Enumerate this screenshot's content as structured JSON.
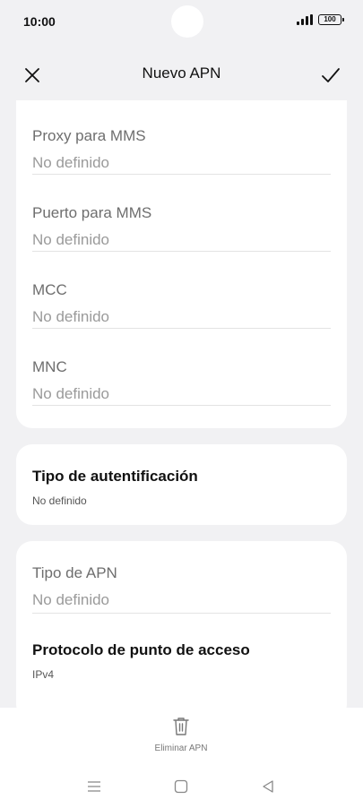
{
  "status_bar": {
    "time": "10:00",
    "battery": "100"
  },
  "app_bar": {
    "title": "Nuevo APN"
  },
  "fields_card": [
    {
      "label": "Proxy para MMS",
      "value": "No definido"
    },
    {
      "label": "Puerto para MMS",
      "value": "No definido"
    },
    {
      "label": "MCC",
      "value": "No definido"
    },
    {
      "label": "MNC",
      "value": "No definido"
    }
  ],
  "auth_card": {
    "title": "Tipo de autentificación",
    "value": "No definido"
  },
  "apn_card": {
    "apn_type_label": "Tipo de APN",
    "apn_type_value": "No definido",
    "protocol_title": "Protocolo de punto de acceso",
    "protocol_value": "IPv4"
  },
  "bottom_action": {
    "delete_label": "Eliminar APN"
  },
  "icons": {
    "close": "close-icon",
    "confirm": "check-icon",
    "delete": "trash-icon",
    "nav_menu": "menu-icon",
    "nav_home": "home-icon",
    "nav_back": "back-icon"
  }
}
